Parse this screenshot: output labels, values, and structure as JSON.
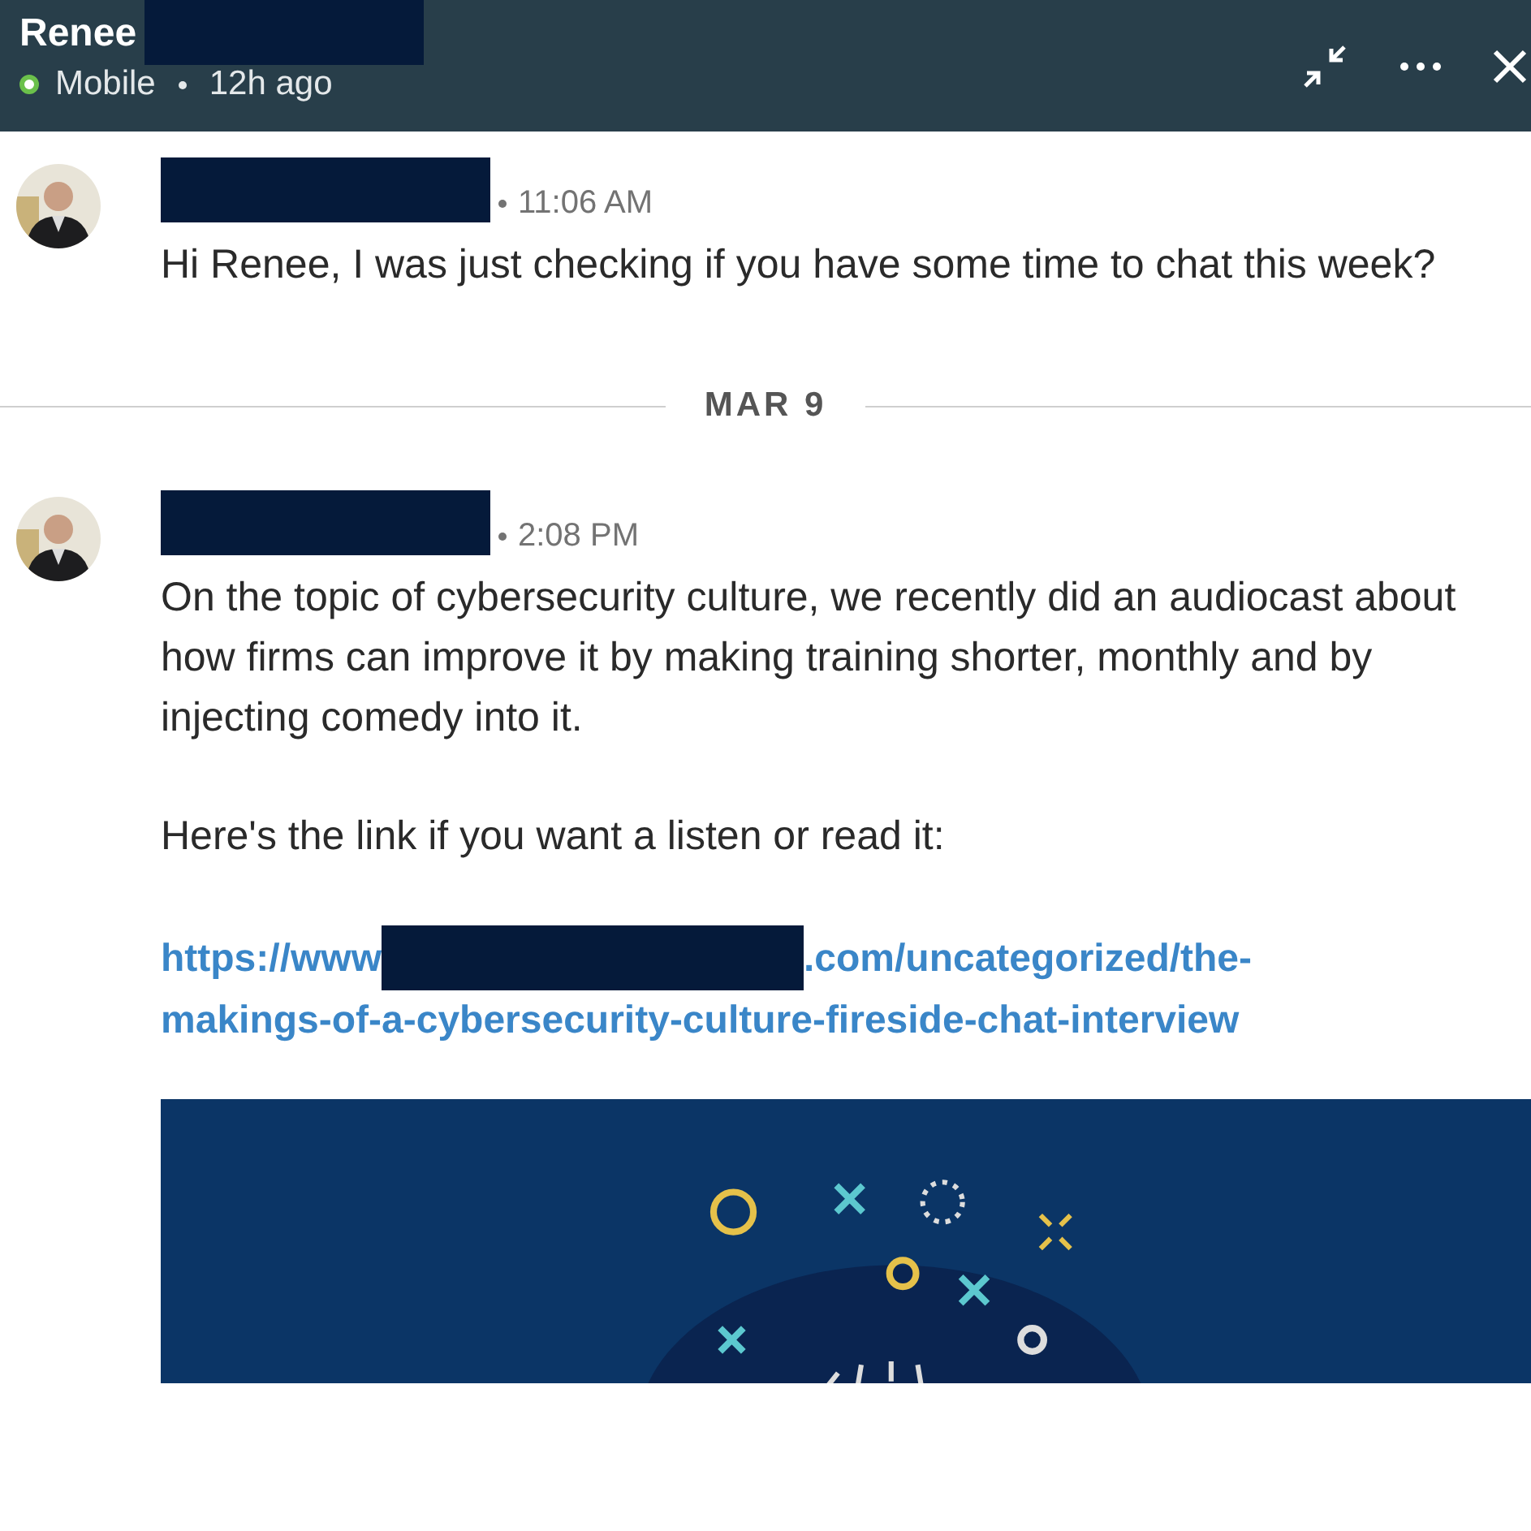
{
  "header": {
    "name": "Renee",
    "name_redacted": true,
    "status": {
      "online": true,
      "device": "Mobile",
      "last_seen": "12h ago"
    }
  },
  "conversation": [
    {
      "kind": "message",
      "sender_redacted": true,
      "time": "11:06 AM",
      "body": [
        {
          "kind": "text",
          "text": "Hi Renee, I was just checking if you have some time to chat this week?"
        }
      ]
    },
    {
      "kind": "date_divider",
      "label": "MAR 9"
    },
    {
      "kind": "message",
      "sender_redacted": true,
      "time": "2:08 PM",
      "body": [
        {
          "kind": "text",
          "text": "On the topic of cybersecurity culture, we recently did an audiocast about how firms can improve it by making training shorter, monthly and by injecting comedy into it."
        },
        {
          "kind": "text",
          "text": "Here's the link if you want a listen or read it:"
        },
        {
          "kind": "link",
          "before": "https://www",
          "redacted": true,
          "after": ".com/uncategorized/the-",
          "line2": "makings-of-a-cybersecurity-culture-fireside-chat-interview"
        },
        {
          "kind": "preview"
        }
      ]
    }
  ]
}
